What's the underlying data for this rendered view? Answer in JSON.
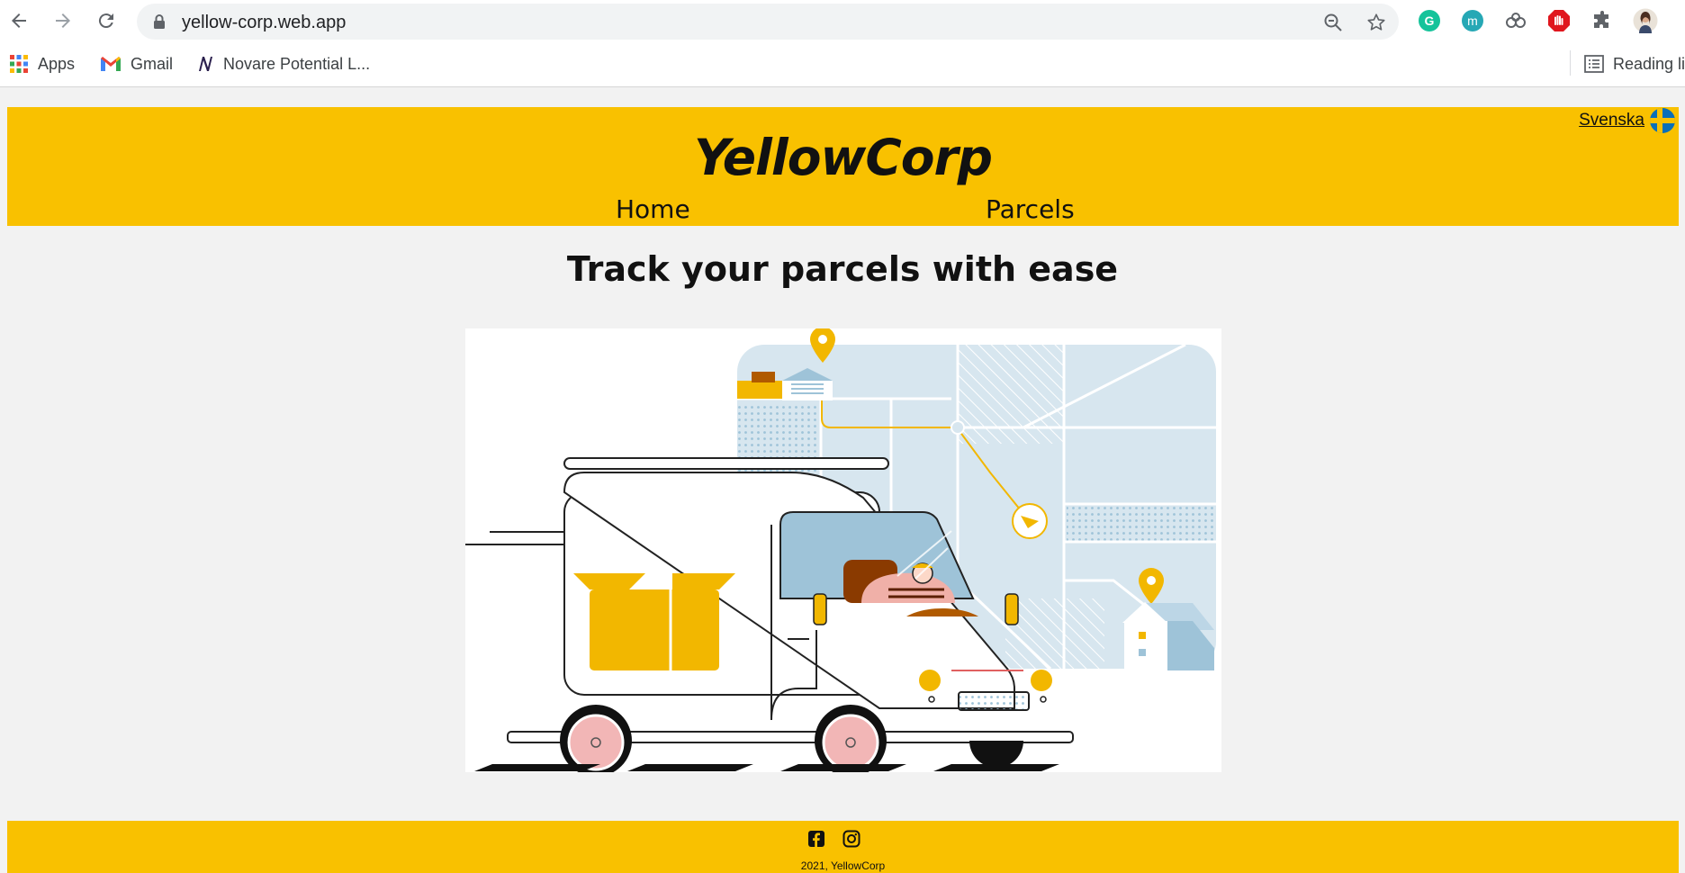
{
  "browser": {
    "url": "yellow-corp.web.app",
    "bookmarks": [
      {
        "label": "Apps",
        "icon": "apps-grid-icon"
      },
      {
        "label": "Gmail",
        "icon": "gmail-icon"
      },
      {
        "label": "Novare Potential L...",
        "icon": "novare-icon"
      }
    ],
    "reading_list_label": "Reading li"
  },
  "site": {
    "brand": "YellowCorp",
    "nav": [
      "Home",
      "Parcels"
    ],
    "language_link": "Svenska",
    "hero_title": "Track your parcels with ease",
    "footer_copy": "2021, YellowCorp"
  },
  "colors": {
    "brand_yellow": "#f9c100",
    "page_bg": "#f2f2f2",
    "map_blue": "#d7e6ef"
  }
}
